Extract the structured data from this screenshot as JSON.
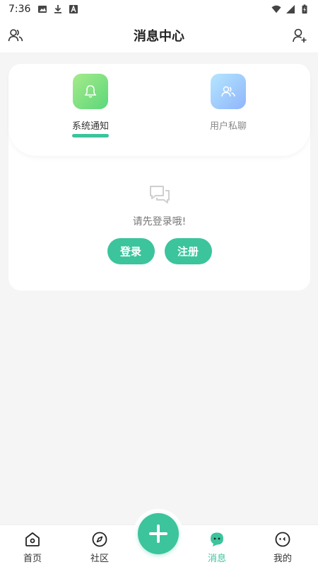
{
  "status_bar": {
    "time": "7:36",
    "icons_left": [
      "image-icon",
      "download-icon",
      "a-letter-icon"
    ],
    "icons_right": [
      "wifi-icon",
      "signal-icon",
      "battery-charging-icon"
    ]
  },
  "header": {
    "title": "消息中心",
    "left_icon": "contacts-icon",
    "right_icon": "add-user-icon"
  },
  "tabs": [
    {
      "label": "系统通知",
      "icon": "bell-icon",
      "active": true
    },
    {
      "label": "用户私聊",
      "icon": "users-icon",
      "active": false
    }
  ],
  "empty_state": {
    "icon": "chat-bubbles-icon",
    "text": "请先登录哦!",
    "login_label": "登录",
    "register_label": "注册"
  },
  "bottom_nav": {
    "items": [
      {
        "label": "首页",
        "icon": "home-icon",
        "active": false
      },
      {
        "label": "社区",
        "icon": "compass-icon",
        "active": false
      },
      {
        "label": "消息",
        "icon": "message-icon",
        "active": true
      },
      {
        "label": "我的",
        "icon": "face-icon",
        "active": false
      }
    ],
    "fab_icon": "plus-icon"
  },
  "colors": {
    "accent": "#3cc49c",
    "background": "#f5f5f5",
    "card": "#ffffff"
  }
}
